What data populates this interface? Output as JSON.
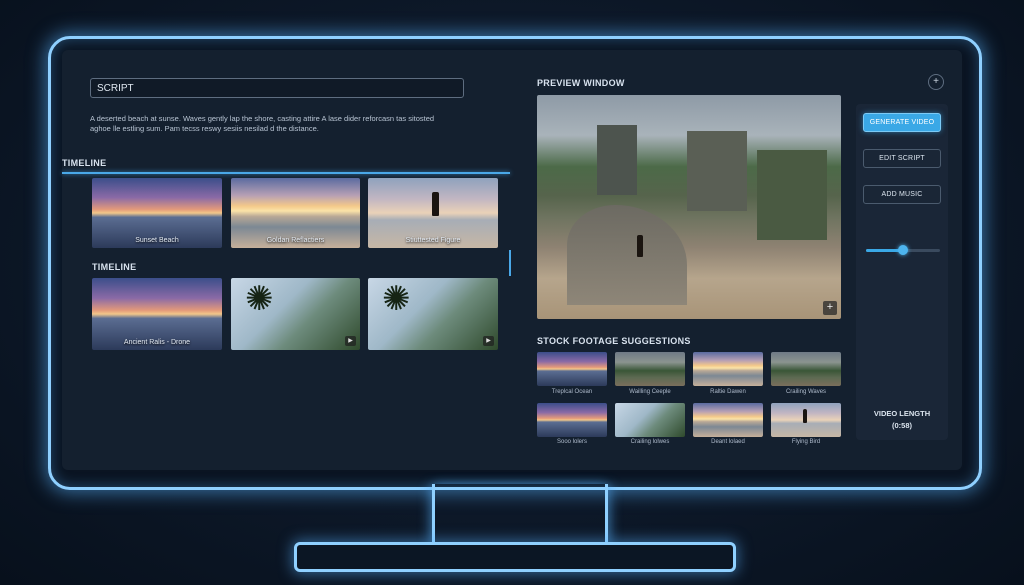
{
  "script": {
    "label": "SCRIPT",
    "text_line1": "A deserted beach at sunse. Waves gently lap the shore, casting attire A lase dider reforcasn tas sitosted",
    "text_line2": "aghoe lle estling sum. Pam tecss reswy sesiis nesilad d the distance."
  },
  "timeline1": {
    "label": "TIMELINE",
    "clips": [
      {
        "caption": "Sunset Beach",
        "style": "sunset"
      },
      {
        "caption": "Goldan Reflactiers",
        "style": "golden"
      },
      {
        "caption": "Stiuttested Figure",
        "style": "figure"
      }
    ]
  },
  "timeline2": {
    "label": "TIMELINE",
    "clips": [
      {
        "caption": "Ancient Ralis - Drone",
        "style": "sunset"
      },
      {
        "caption": "",
        "style": "palm"
      },
      {
        "caption": "",
        "style": "palm"
      }
    ]
  },
  "preview": {
    "label": "PREVIEW WINDOW",
    "expand_glyph": "+",
    "add_glyph": "+"
  },
  "stock": {
    "label": "STOCK FOOTAGE SUGGESTIONS",
    "items": [
      {
        "caption": "Treplcal Ocean",
        "style": "sunset"
      },
      {
        "caption": "Wailling Ceeple",
        "style": "ruins"
      },
      {
        "caption": "Raltie Dawen",
        "style": "golden"
      },
      {
        "caption": "Crailing Waves",
        "style": "ruins"
      },
      {
        "caption": "Sooo lolers",
        "style": "sunset"
      },
      {
        "caption": "Crailing lolwes",
        "style": "palm"
      },
      {
        "caption": "Deant lolaed",
        "style": "golden"
      },
      {
        "caption": "Flying Bird",
        "style": "figure"
      }
    ]
  },
  "controls": {
    "generate_label": "GENERATE VIDEO",
    "edit_label": "EDIT SCRIPT",
    "music_label": "ADD MUSIC",
    "slider_level": 0.5,
    "video_length_label": "VIDEO LENGTH",
    "video_length_value": "(0:58)"
  },
  "colors": {
    "accent": "#3aa8e6",
    "glow": "#8fd0ff",
    "panel": "#14202f"
  }
}
